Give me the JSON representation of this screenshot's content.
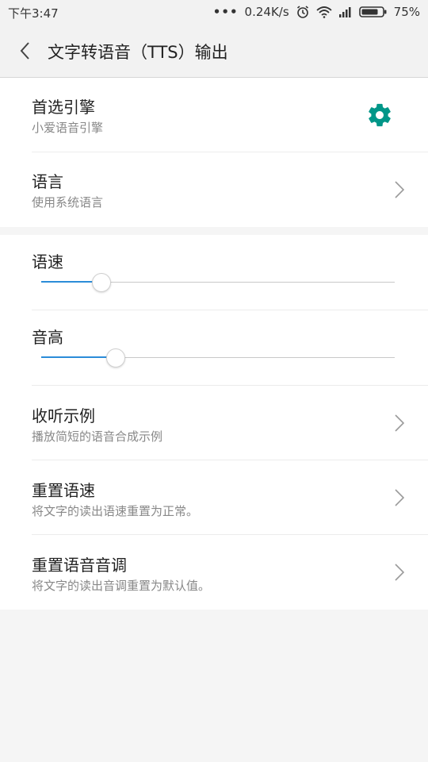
{
  "status_bar": {
    "time": "下午3:47",
    "network_speed": "0.24K/s",
    "battery": "75%",
    "icons": [
      "dots-icon",
      "alarm-icon",
      "wifi-icon",
      "signal-icon",
      "battery-icon"
    ]
  },
  "app_bar": {
    "back_icon": "chevron-left-icon",
    "title": "文字转语音（TTS）输出"
  },
  "settings": {
    "preferred_engine": {
      "label": "首选引擎",
      "summary": "小爱语音引擎",
      "icon": "gear-icon",
      "icon_color": "#009688"
    },
    "language": {
      "label": "语言",
      "summary": "使用系统语言",
      "icon": "chevron-right-icon"
    },
    "speech_rate": {
      "label": "语速",
      "value": 0.17
    },
    "pitch": {
      "label": "音高",
      "value": 0.21
    },
    "listen_example": {
      "label": "收听示例",
      "summary": "播放简短的语音合成示例",
      "icon": "chevron-right-icon"
    },
    "reset_rate": {
      "label": "重置语速",
      "summary": "将文字的读出语速重置为正常。",
      "icon": "chevron-right-icon"
    },
    "reset_pitch": {
      "label": "重置语音音调",
      "summary": "将文字的读出音调重置为默认值。",
      "icon": "chevron-right-icon"
    }
  },
  "colors": {
    "accent": "#2b8cd8",
    "gear": "#009688",
    "background": "#f5f5f5"
  }
}
